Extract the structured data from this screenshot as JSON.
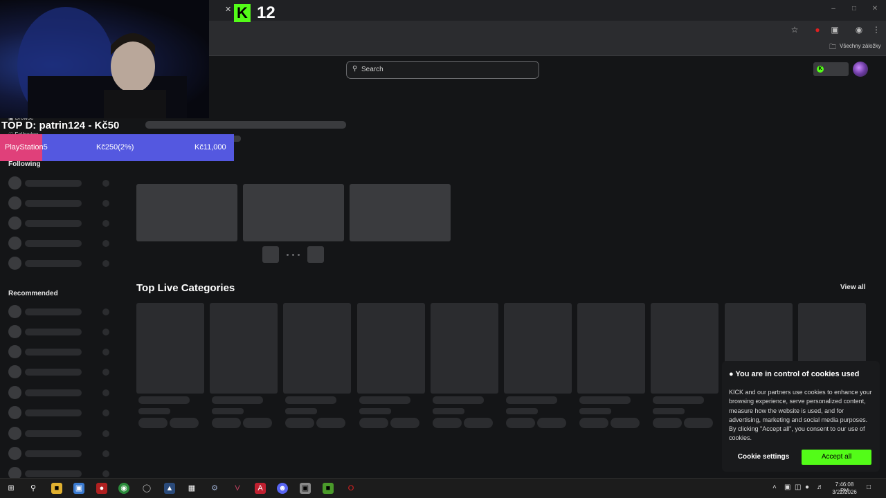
{
  "browser": {
    "bookmarks_label": "Všechny záložky"
  },
  "overlay": {
    "viewer_count": "12",
    "top_donor": "TOP D: patrin124 - Kč50",
    "goal": {
      "name": "PlayStation5",
      "progress_text": "Kč250(2%)",
      "progress_fraction": 0.02,
      "target": "Kč11,000"
    }
  },
  "site": {
    "search_placeholder": "Search",
    "sidebar": {
      "browse": "Browse",
      "following_top": "Following",
      "following": "Following",
      "recommended": "Recommended"
    },
    "top_categories": {
      "title": "Top Live Categories",
      "view_all": "View all"
    },
    "cookie": {
      "title": "You are in control of cookies used",
      "body": "KICK and our partners use cookies to enhance your browsing experience, serve personalized content, measure how the website is used, and for advertising, marketing and social media purposes. By clicking \"Accept all\", you consent to our use of cookies.",
      "settings_label": "Cookie settings",
      "accept_label": "Accept all"
    }
  },
  "taskbar": {
    "time": "7:46:08 PM",
    "date": "3/22/2026"
  },
  "colors": {
    "accent": "#53fc18",
    "goal_bar": "#5458e0",
    "goal_accent": "#e0407a",
    "background": "#141517"
  }
}
